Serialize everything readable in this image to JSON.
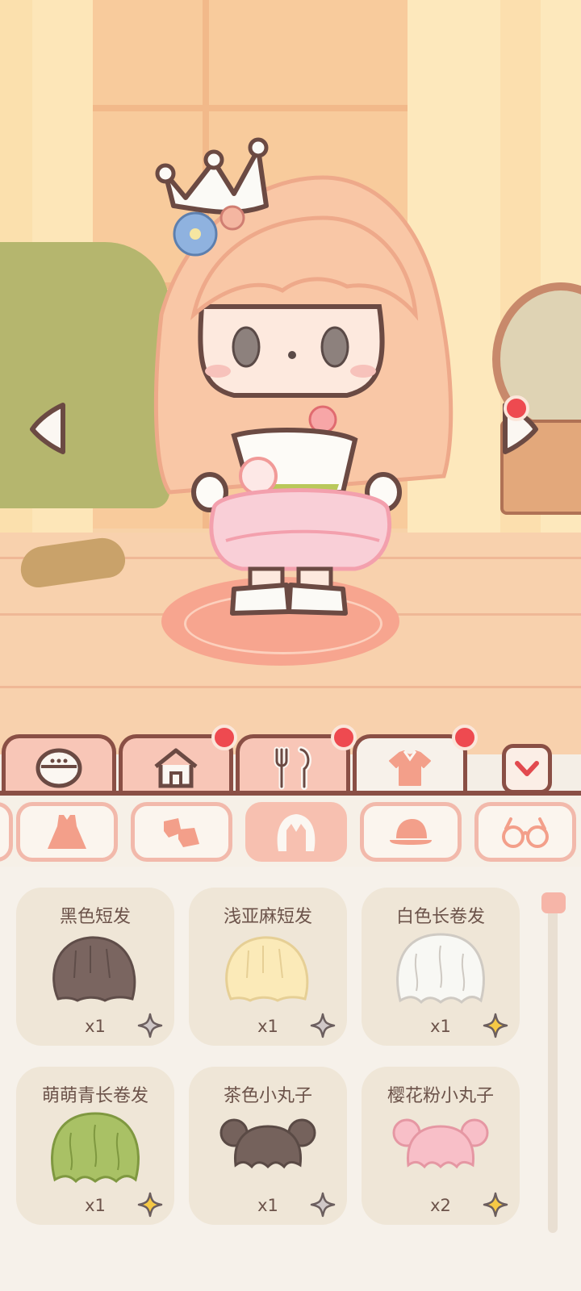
{
  "colors": {
    "panel_bg": "#f6f1ea",
    "tab_border": "#8a4f45",
    "tab_fill": "#f8c6b7",
    "card_bg": "#efe6d7",
    "text": "#6c534a",
    "notification": "#ee4a50"
  },
  "scene": {
    "left_arrow_icon": "chevron-left-icon",
    "right_arrow_icon": "chevron-right-icon",
    "right_arrow_has_badge": true
  },
  "main_tabs": [
    {
      "icon": "face-icon",
      "active": false,
      "badge": false
    },
    {
      "icon": "house-icon",
      "active": false,
      "badge": true
    },
    {
      "icon": "food-icon",
      "active": false,
      "badge": true
    },
    {
      "icon": "shirt-icon",
      "active": true,
      "badge": true
    }
  ],
  "collapse_icon": "chevron-down-icon",
  "sub_tabs": [
    {
      "icon": "dress-icon",
      "active": false
    },
    {
      "icon": "shoes-icon",
      "active": false
    },
    {
      "icon": "hair-icon",
      "active": true
    },
    {
      "icon": "hat-icon",
      "active": false
    },
    {
      "icon": "glasses-icon",
      "active": false
    }
  ],
  "items": [
    {
      "name": "黑色短发",
      "count": "x1",
      "color": "#7a6560",
      "star": "grey"
    },
    {
      "name": "浅亚麻短发",
      "count": "x1",
      "color": "#fbeab8",
      "star": "grey"
    },
    {
      "name": "白色长卷发",
      "count": "x1",
      "color": "#f8f8f4",
      "star": "gold"
    },
    {
      "name": "萌萌青长卷发",
      "count": "x1",
      "color": "#a9c165",
      "star": "gold"
    },
    {
      "name": "茶色小丸子",
      "count": "x1",
      "color": "#75625c",
      "star": "grey"
    },
    {
      "name": "樱花粉小丸子",
      "count": "x2",
      "color": "#f8bfc8",
      "star": "gold"
    }
  ]
}
